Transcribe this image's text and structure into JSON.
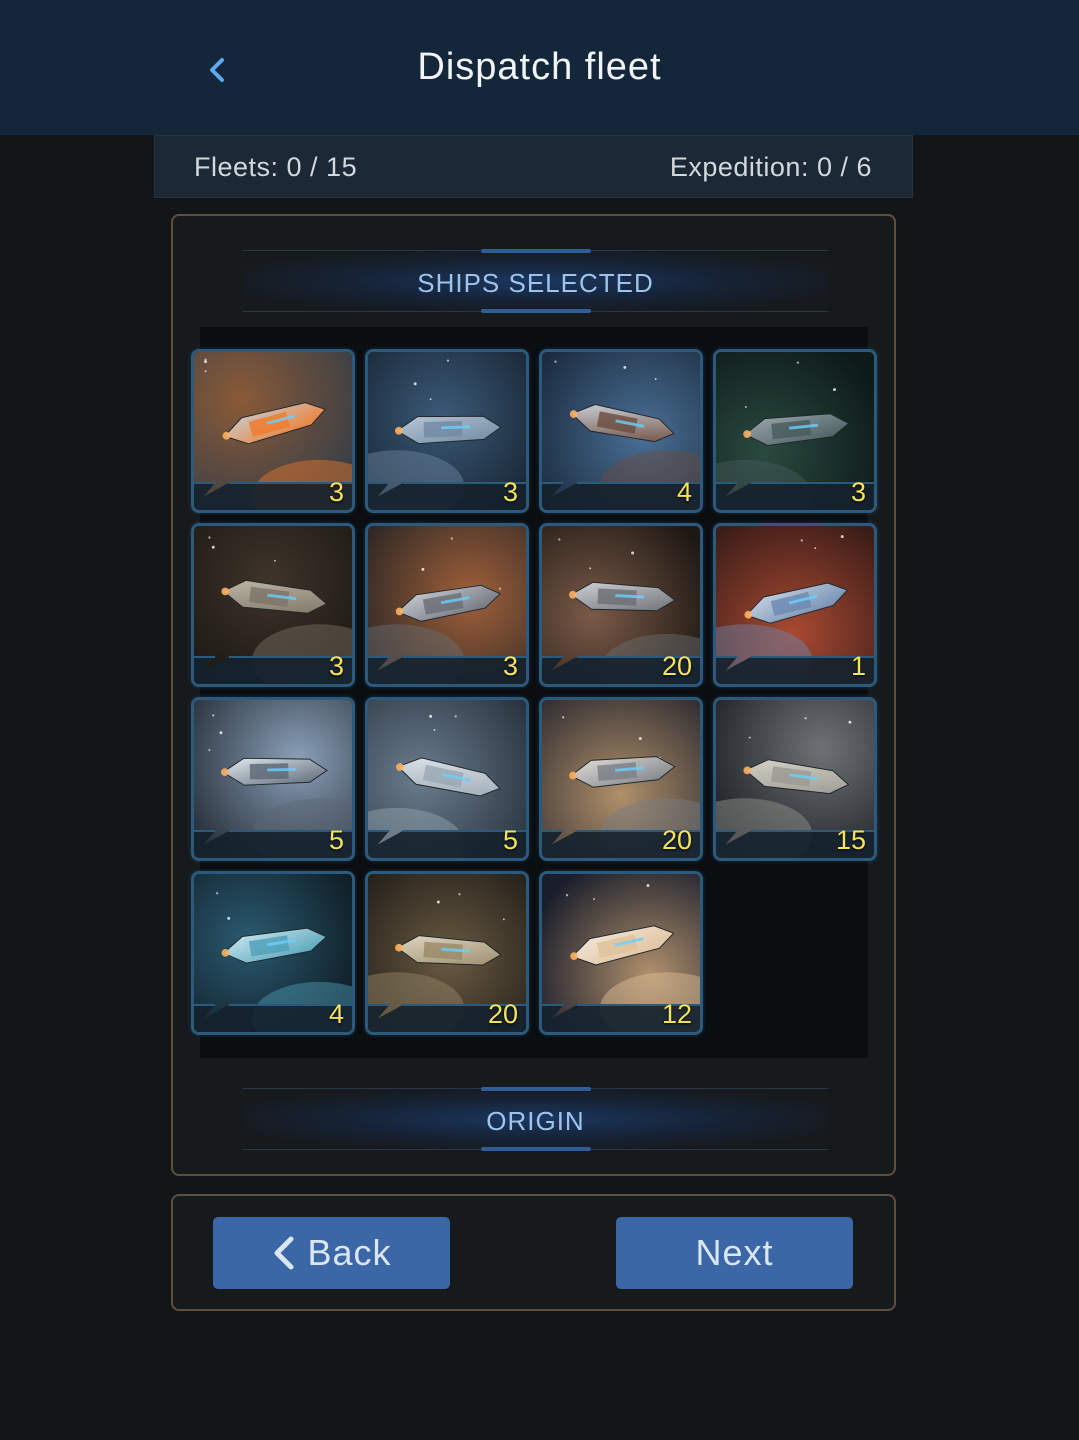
{
  "header": {
    "title": "Dispatch fleet",
    "back_icon": "chevron-left-icon"
  },
  "stats": {
    "fleets": "Fleets: 0 / 15",
    "expedition": "Expedition: 0 / 6"
  },
  "sections": {
    "ships_selected": "SHIPS SELECTED",
    "origin": "ORIGIN"
  },
  "ships": [
    {
      "count": "3",
      "scene": "fighter-explosion"
    },
    {
      "count": "3",
      "scene": "cruiser-planet"
    },
    {
      "count": "4",
      "scene": "frigate-earth"
    },
    {
      "count": "3",
      "scene": "destroyer-nebula"
    },
    {
      "count": "3",
      "scene": "battleship-dark"
    },
    {
      "count": "3",
      "scene": "hauler-mars"
    },
    {
      "count": "20",
      "scene": "carrier-orbit"
    },
    {
      "count": "1",
      "scene": "station-red"
    },
    {
      "count": "5",
      "scene": "interceptor-light"
    },
    {
      "count": "5",
      "scene": "scout-moon"
    },
    {
      "count": "20",
      "scene": "transport-sunset"
    },
    {
      "count": "15",
      "scene": "freighter-moon"
    },
    {
      "count": "4",
      "scene": "saucer-blue"
    },
    {
      "count": "20",
      "scene": "miner-asteroids"
    },
    {
      "count": "12",
      "scene": "lander-desert"
    }
  ],
  "buttons": {
    "back": "Back",
    "next": "Next"
  },
  "colors": {
    "accent": "#3b67a6",
    "count": "#f5e35a",
    "header_bg": "#13263a",
    "card_border": "#2c5a7c",
    "panel_border": "#5c4f3d"
  }
}
